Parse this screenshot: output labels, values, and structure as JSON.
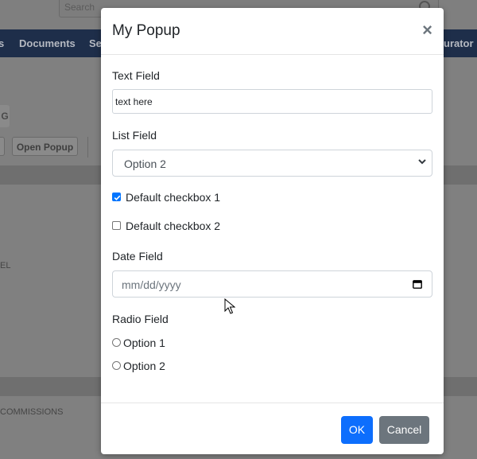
{
  "background": {
    "search_placeholder": "Search",
    "nav": {
      "documents": "Documents",
      "settings_partial": "Se",
      "nav_left_partial": "s",
      "nav_right_partial": "urator"
    },
    "panel_letter": "G",
    "open_popup_label": "Open Popup",
    "side_text_1": "EL",
    "side_text_2": "COMMISSIONS"
  },
  "modal": {
    "title": "My Popup",
    "close_symbol": "×",
    "text_field": {
      "label": "Text Field",
      "value": "text here"
    },
    "list_field": {
      "label": "List Field",
      "selected": "Option 2"
    },
    "checkbox_1": {
      "label": "Default checkbox 1",
      "checked": true
    },
    "checkbox_2": {
      "label": "Default checkbox 2",
      "checked": false
    },
    "date_field": {
      "label": "Date Field",
      "placeholder": "mm/dd/yyyy"
    },
    "radio_field": {
      "label": "Radio Field",
      "options": [
        {
          "label": "Option 1"
        },
        {
          "label": "Option 2"
        }
      ]
    },
    "ok_label": "OK",
    "cancel_label": "Cancel"
  },
  "colors": {
    "primary": "#0d6efd",
    "secondary": "#6c757d",
    "nav_bg": "#1e2e4a"
  }
}
